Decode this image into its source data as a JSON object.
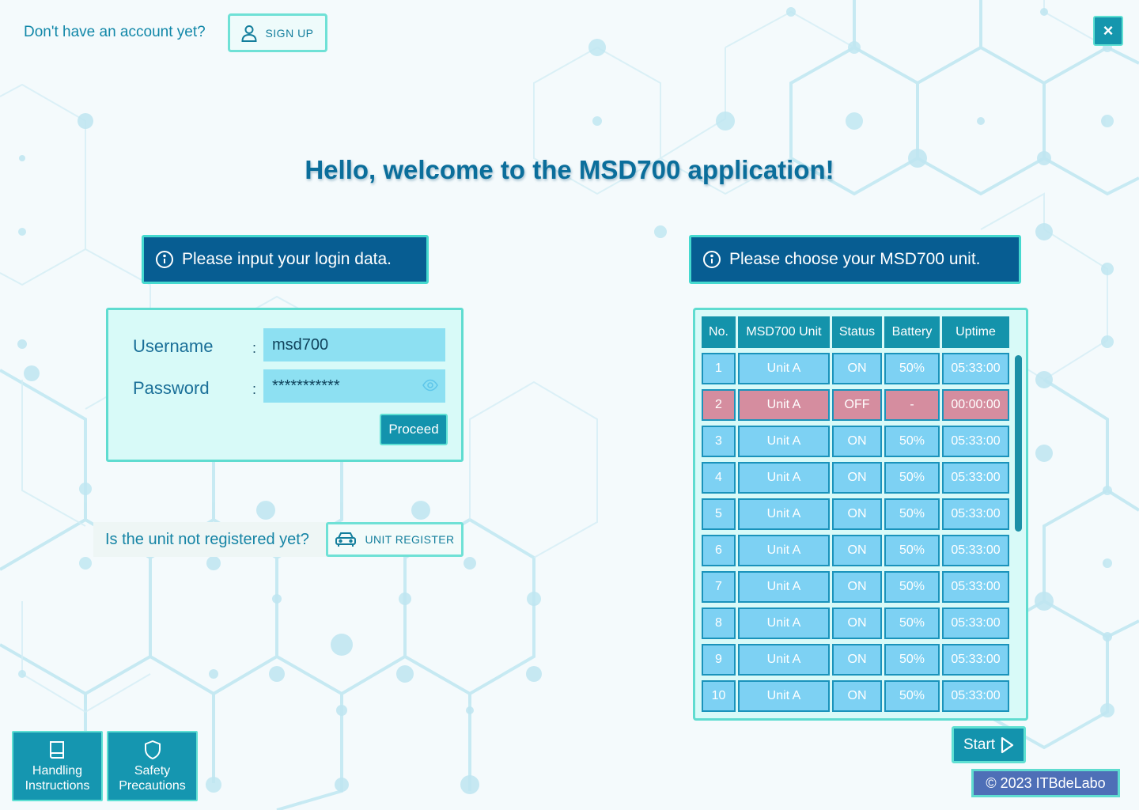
{
  "top_bar": {
    "signup_prompt": "Don't have an account yet?",
    "signup_label": "SIGN UP",
    "close_label": "×"
  },
  "title": "Hello, welcome to the MSD700 application!",
  "login": {
    "banner": "Please input your login data.",
    "username_label": "Username",
    "password_label": "Password",
    "colon": ":",
    "username_value": "msd700",
    "password_value": "***********",
    "proceed_label": "Proceed"
  },
  "unit_register": {
    "prompt": "Is the unit not registered yet?",
    "button_label": "UNIT REGISTER"
  },
  "units": {
    "banner": "Please choose your MSD700 unit.",
    "columns": [
      "No.",
      "MSD700 Unit",
      "Status",
      "Battery",
      "Uptime"
    ],
    "rows": [
      {
        "no": "1",
        "unit": "Unit A",
        "status": "ON",
        "battery": "50%",
        "uptime": "05:33:00"
      },
      {
        "no": "2",
        "unit": "Unit A",
        "status": "OFF",
        "battery": "-",
        "uptime": "00:00:00"
      },
      {
        "no": "3",
        "unit": "Unit A",
        "status": "ON",
        "battery": "50%",
        "uptime": "05:33:00"
      },
      {
        "no": "4",
        "unit": "Unit A",
        "status": "ON",
        "battery": "50%",
        "uptime": "05:33:00"
      },
      {
        "no": "5",
        "unit": "Unit A",
        "status": "ON",
        "battery": "50%",
        "uptime": "05:33:00"
      },
      {
        "no": "6",
        "unit": "Unit A",
        "status": "ON",
        "battery": "50%",
        "uptime": "05:33:00"
      },
      {
        "no": "7",
        "unit": "Unit A",
        "status": "ON",
        "battery": "50%",
        "uptime": "05:33:00"
      },
      {
        "no": "8",
        "unit": "Unit A",
        "status": "ON",
        "battery": "50%",
        "uptime": "05:33:00"
      },
      {
        "no": "9",
        "unit": "Unit A",
        "status": "ON",
        "battery": "50%",
        "uptime": "05:33:00"
      },
      {
        "no": "10",
        "unit": "Unit A",
        "status": "ON",
        "battery": "50%",
        "uptime": "05:33:00"
      }
    ],
    "start_label": "Start"
  },
  "footer": {
    "handling_label_1": "Handling",
    "handling_label_2": "Instructions",
    "safety_label_1": "Safety",
    "safety_label_2": "Precautions",
    "copyright": "© 2023 ITBdeLabo"
  },
  "icons": {
    "signup": "user-icon",
    "close": "close-icon",
    "info": "info-icon",
    "eye": "eye-icon",
    "car": "car-icon",
    "play": "play-icon",
    "book": "book-icon",
    "shield": "shield-icon"
  },
  "colors": {
    "accent": "#1393ad",
    "border": "#5fdcd0",
    "banner": "#075d92",
    "row_on": "#7dd1f3",
    "row_off": "#d58d9f",
    "copyright_bg": "#4e6fb7"
  }
}
